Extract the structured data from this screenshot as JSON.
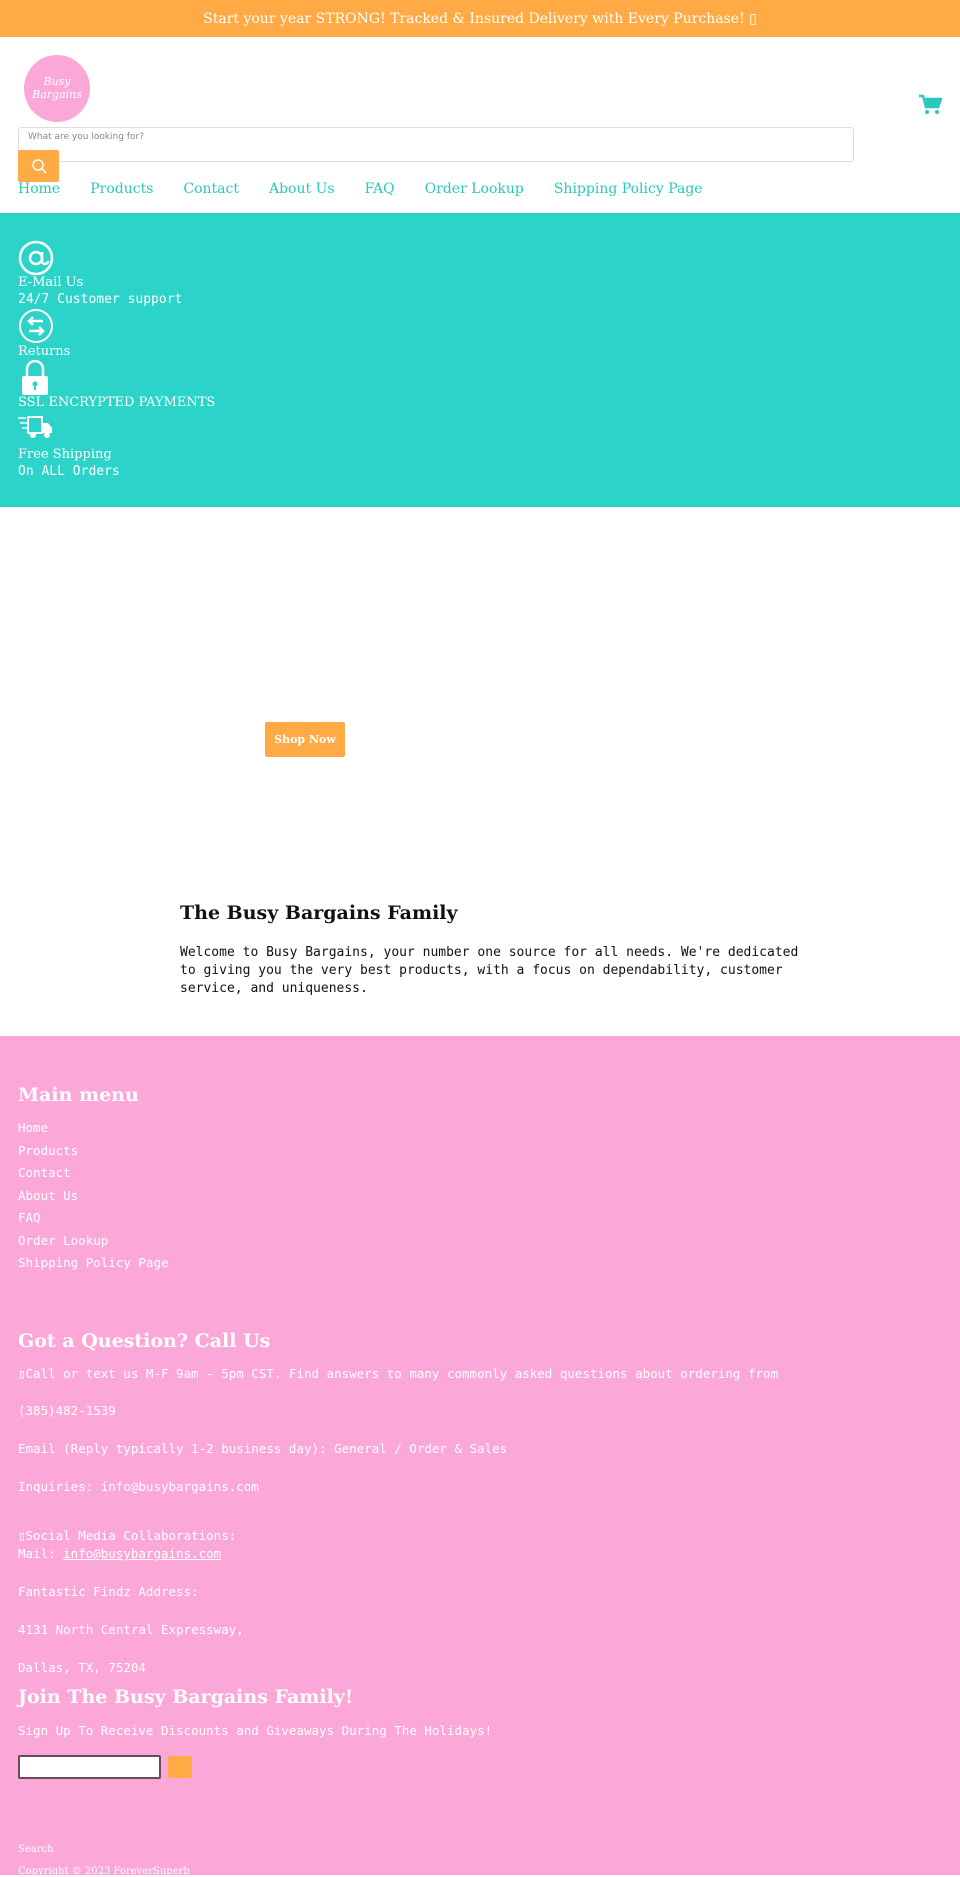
{
  "announcement": "Start your year STRONG! Tracked & Insured Delivery with Every Purchase! ▯",
  "logo_text": "Busy Bargains",
  "search": {
    "placeholder": "What are you looking for?"
  },
  "nav": [
    "Home",
    "Products",
    "Contact",
    "About Us",
    "FAQ",
    "Order Lookup",
    "Shipping Policy Page"
  ],
  "features": [
    {
      "icon": "at-sign-icon",
      "title": "E-Mail Us",
      "subtitle": "24/7 Customer support"
    },
    {
      "icon": "returns-icon",
      "title": "Returns"
    },
    {
      "icon": "lock-icon",
      "title": "SSL ENCRYPTED PAYMENTS"
    },
    {
      "icon": "truck-icon",
      "title": "Free Shipping",
      "subtitle": "On ALL Orders"
    }
  ],
  "hero": {
    "button": "Shop Now"
  },
  "about": {
    "title": "The Busy Bargains Family",
    "body": "Welcome to Busy Bargains, your number one source for all needs. We're dedicated to giving you the very best products, with a focus on dependability, customer service, and uniqueness."
  },
  "footer": {
    "menu_title": "Main menu",
    "menu": [
      "Home",
      "Products",
      "Contact",
      "About Us",
      "FAQ",
      "Order Lookup",
      "Shipping Policy Page"
    ],
    "question_title": "Got a Question? Call Us",
    "q_lines": [
      "▯Call or text us M-F 9am - 5pm CST. Find answers to many commonly asked questions about ordering from",
      "(385)482-1539",
      "Email (Reply typically 1-2 business day): General / Order & Sales",
      "Inquiries: info@busybargains.com",
      "▯Social Media Collaborations:",
      "Mail: ",
      "info@busybargains.com",
      "Fantastic Findz Address:",
      "4131 North Central Expressway,",
      "Dallas, TX, 75204"
    ],
    "join_title": "Join The Busy Bargains Family!",
    "join_text": "Sign Up To Receive Discounts and Giveaways During The Holidays!",
    "search_link": "Search",
    "copyright": "Copyright © 2023 ForeverSuperb"
  },
  "colors": {
    "orange": "#ffaa45",
    "teal": "#2cd3c8",
    "pink": "#fba8d9"
  }
}
